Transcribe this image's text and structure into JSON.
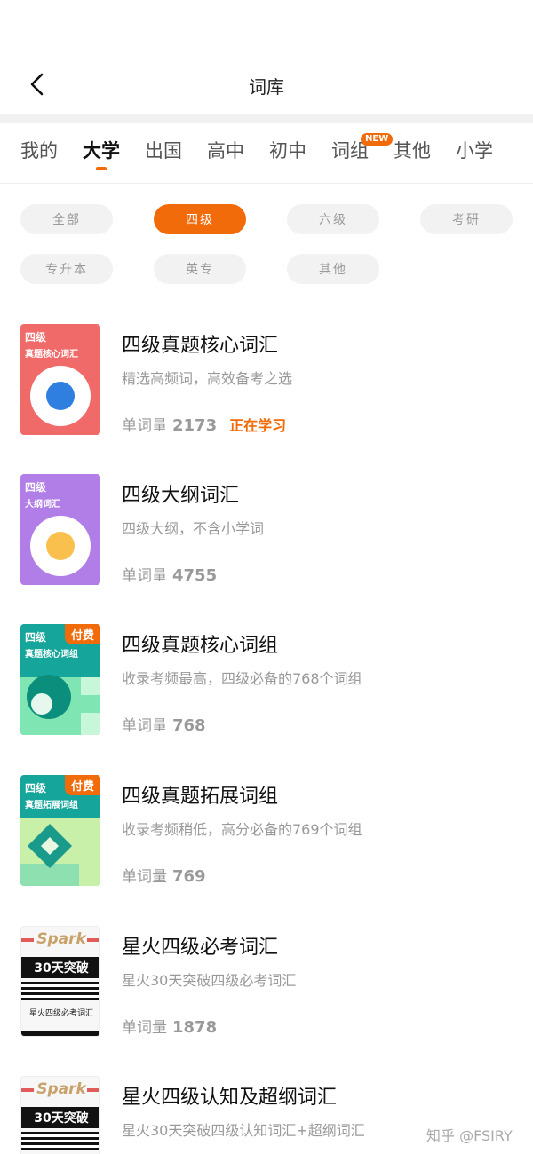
{
  "header": {
    "title": "词库"
  },
  "tabs": [
    {
      "label": "我的"
    },
    {
      "label": "大学"
    },
    {
      "label": "出国"
    },
    {
      "label": "高中"
    },
    {
      "label": "初中"
    },
    {
      "label": "词组",
      "badge": "NEW"
    },
    {
      "label": "其他"
    },
    {
      "label": "小学"
    }
  ],
  "filters": [
    {
      "label": "全部"
    },
    {
      "label": "四级"
    },
    {
      "label": "六级"
    },
    {
      "label": "考研"
    },
    {
      "label": "专升本"
    },
    {
      "label": "英专"
    },
    {
      "label": "其他"
    }
  ],
  "books": [
    {
      "cover_title": "四级",
      "cover_sub": "真题核心词汇",
      "title": "四级真题核心词汇",
      "desc": "精选高频词，高效备考之选",
      "count_label": "单词量",
      "count": "2173",
      "status": "正在学习",
      "cover_color": "#f06a6a",
      "accent": "#2e7fe0"
    },
    {
      "cover_title": "四级",
      "cover_sub": "大纲词汇",
      "title": "四级大纲词汇",
      "desc": "四级大纲，不含小学词",
      "count_label": "单词量",
      "count": "4755",
      "cover_color": "#b07ee6",
      "accent": "#f9c04e"
    },
    {
      "cover_title": "四级",
      "cover_sub": "真题核心词组",
      "badge": "付费",
      "title": "四级真题核心词组",
      "desc": "收录考频最高，四级必备的768个词组",
      "count_label": "单词量",
      "count": "768",
      "cover_color": "#16a59a",
      "accent": "#7fe5b3"
    },
    {
      "cover_title": "四级",
      "cover_sub": "真题拓展词组",
      "badge": "付费",
      "title": "四级真题拓展词组",
      "desc": "收录考频稍低，高分必备的769个词组",
      "count_label": "单词量",
      "count": "769",
      "cover_color": "#16a59a",
      "accent": "#c8f0a8"
    },
    {
      "cover_logo": "Spark",
      "cover_band": "30天突破",
      "cover_sub": "星火四级必考词汇",
      "title": "星火四级必考词汇",
      "desc": "星火30天突破四级必考词汇",
      "count_label": "单词量",
      "count": "1878"
    },
    {
      "cover_logo": "Spark",
      "cover_band": "30天突破",
      "title": "星火四级认知及超纲词汇",
      "desc": "星火30天突破四级认知词汇+超纲词汇"
    }
  ],
  "colors": {
    "accent": "#f26b0a"
  },
  "watermark": "知乎 @FSIRY"
}
